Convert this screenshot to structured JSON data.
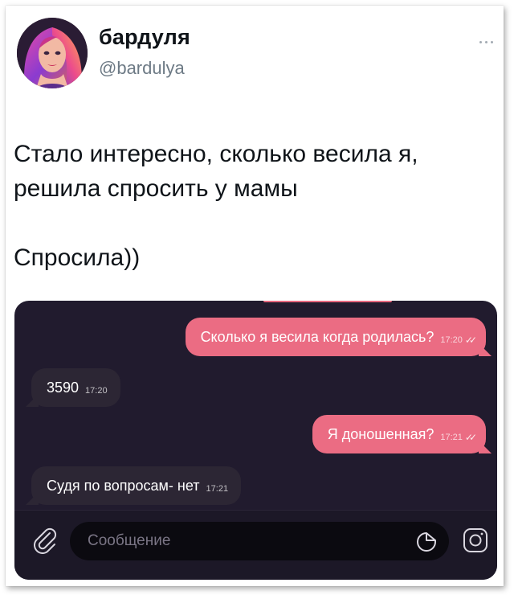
{
  "tweet": {
    "author_name": "бардуля",
    "author_handle": "@bardulya",
    "text_lines": [
      "Стало интересно, сколько весила я,",
      "решила спросить у мамы",
      "Спросила))"
    ]
  },
  "chat": {
    "messages": [
      {
        "direction": "out",
        "text": "Сколько я весила когда родилась?",
        "time": "17:20",
        "read": true
      },
      {
        "direction": "in",
        "text": "3590",
        "time": "17:20"
      },
      {
        "direction": "out",
        "text": "Я доношенная?",
        "time": "17:21",
        "read": true
      },
      {
        "direction": "in",
        "text": "Судя по вопросам- нет",
        "time": "17:21"
      }
    ],
    "input_placeholder": "Сообщение",
    "icons": [
      "paperclip-icon",
      "sticker-icon",
      "camera-icon"
    ]
  },
  "colors": {
    "outgoing_bubble": "#eb6c83",
    "incoming_bubble": "#2c2634",
    "chat_background": "#211b2e"
  }
}
